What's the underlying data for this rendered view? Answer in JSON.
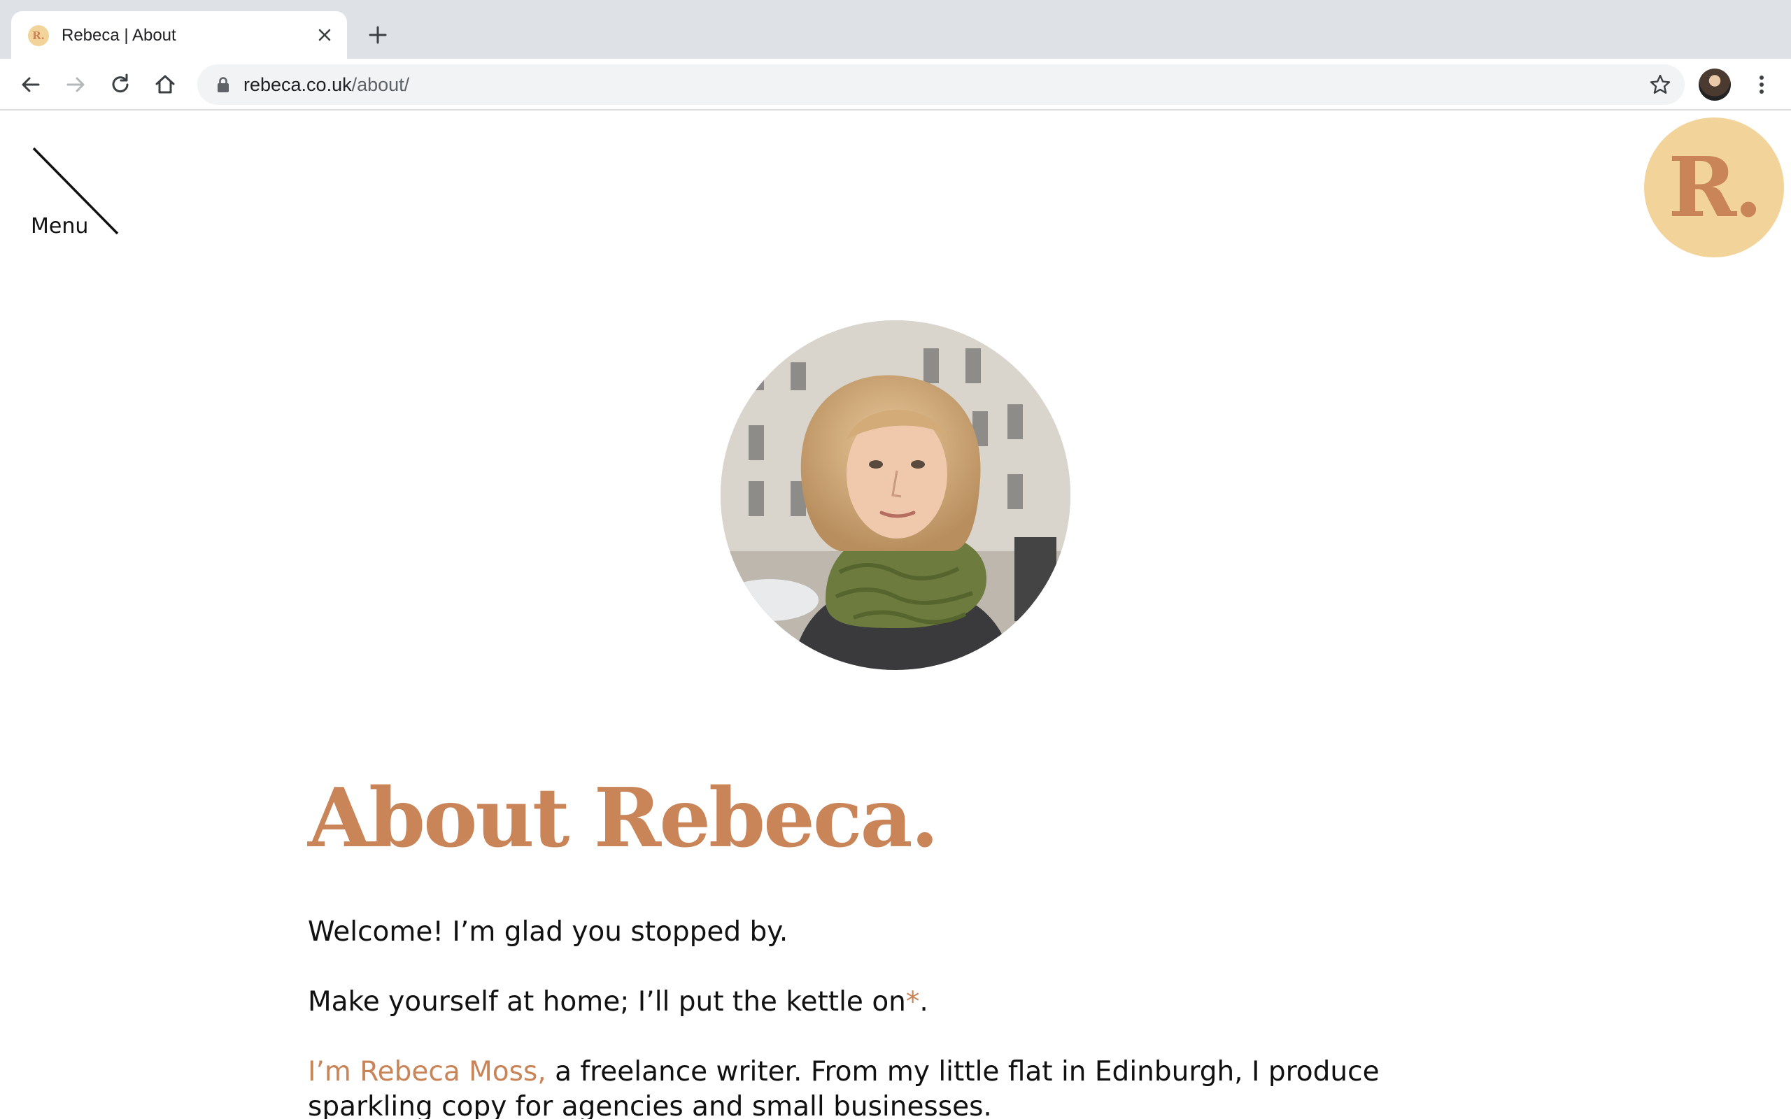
{
  "browser": {
    "tab_title": "Rebeca | About",
    "favicon_text": "R.",
    "url_domain": "rebeca.co.uk",
    "url_path": "/about/"
  },
  "header": {
    "menu_label": "Menu",
    "logo_text": "R."
  },
  "main": {
    "title": "About Rebeca.",
    "paragraphs": {
      "p1": "Welcome! I’m glad you stopped by.",
      "p2": "Make yourself at home; I’ll put the kettle on",
      "p2_asterisk": "*",
      "p2_end": ".",
      "p3_link": "I’m Rebeca Moss,",
      "p3_text": " a freelance writer. From my little flat in Edinburgh, I produce sparkling copy for agencies and small businesses."
    }
  },
  "colors": {
    "accent": "#c98458",
    "logo_bg": "#f2d49b",
    "tabbar_bg": "#dee1e6"
  }
}
